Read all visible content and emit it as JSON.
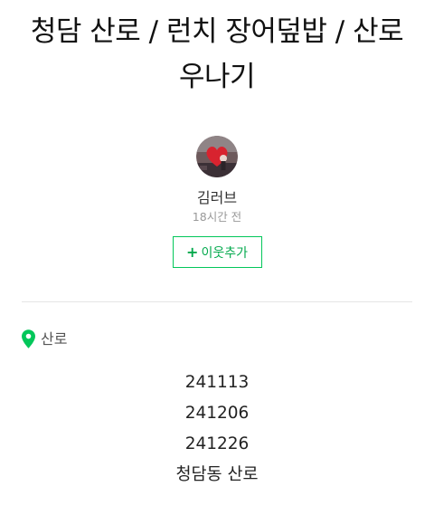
{
  "post": {
    "title": "청담 산로 / 런치 장어덮밥 / 산로 우나기"
  },
  "author": {
    "name": "김러브",
    "time": "18시간 전",
    "add_neighbor_label": "이웃추가",
    "add_neighbor_icon": "plus-icon"
  },
  "place": {
    "label": "산로",
    "icon": "map-pin-icon",
    "color": "#03c75a"
  },
  "content": {
    "lines": [
      "241113",
      "241206",
      "241226",
      "청담동 산로"
    ]
  },
  "colors": {
    "accent": "#03c75a",
    "meta_text": "#999999"
  }
}
